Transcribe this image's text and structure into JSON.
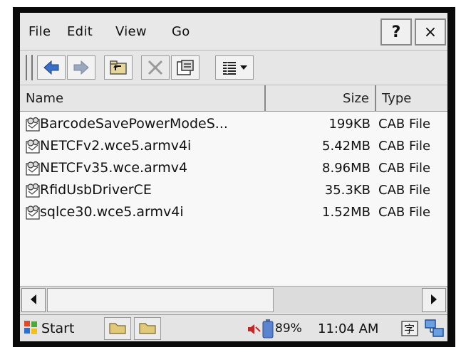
{
  "menu": {
    "file": "File",
    "edit": "Edit",
    "view": "View",
    "go": "Go",
    "help_button": "?",
    "close_button": "×"
  },
  "columns": {
    "name": "Name",
    "size": "Size",
    "type": "Type"
  },
  "files": [
    {
      "name": "BarcodeSavePowerModeS...",
      "size": "199KB",
      "type": "CAB File",
      "icon": "cab-file-icon"
    },
    {
      "name": "NETCFv2.wce5.armv4i",
      "size": "5.42MB",
      "type": "CAB File",
      "icon": "cab-file-icon"
    },
    {
      "name": "NETCFv35.wce.armv4",
      "size": "8.96MB",
      "type": "CAB File",
      "icon": "cab-file-icon"
    },
    {
      "name": "RfidUsbDriverCE",
      "size": "35.3KB",
      "type": "CAB File",
      "icon": "cab-file-icon"
    },
    {
      "name": "sqlce30.wce5.armv4i",
      "size": "1.52MB",
      "type": "CAB File",
      "icon": "cab-file-icon"
    }
  ],
  "taskbar": {
    "start_label": "Start",
    "battery_percent": "89%",
    "clock": "11:04 AM"
  },
  "colors": {
    "window_bg": "#f4f4f4",
    "chrome": "#e6e6e6",
    "bezel": "#0a0a0a",
    "accent_blue": "#3a6fc8"
  }
}
